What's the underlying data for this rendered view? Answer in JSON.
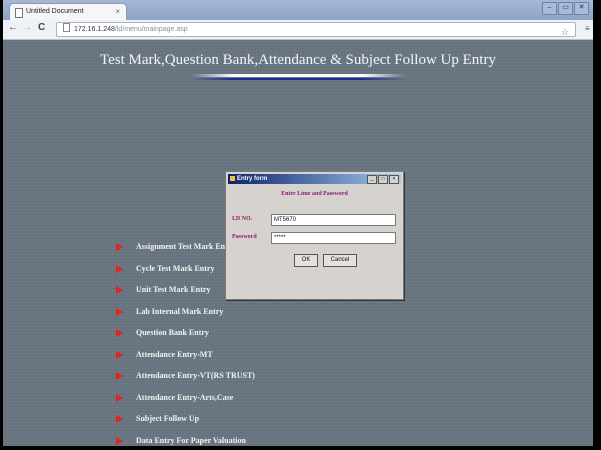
{
  "browser": {
    "tab_title": "Untitled Document",
    "tab_close": "×",
    "url_host": "172.16.1.248",
    "url_path": "/ld/menu/mainpage.asp",
    "window_controls": [
      "–",
      "▭",
      "✕"
    ],
    "nav": {
      "back": "←",
      "forward": "→",
      "reload": "C"
    },
    "bookmark_icon": "star-icon"
  },
  "page": {
    "title": "Test Mark,Question Bank,Attendance & Subject Follow Up Entry",
    "menu_items": [
      "Assignment Test Mark Entry",
      "Cycle Test Mark Entry",
      "Unit Test Mark Entry",
      "Lab Internal Mark Entry",
      "Question Bank Entry",
      "Attendance Entry-MT",
      "Attendance Entry-VT(RS TRUST)",
      "Attendance Entry-Arts,Case",
      "Subject Follow Up",
      "Data Entry For Paper Valuation"
    ]
  },
  "dialog": {
    "title": "Entry form",
    "heading": "Enter Lime and Password",
    "userid_label": "I.D NO.",
    "userid_value": "MT5670",
    "password_label": "Password",
    "password_value": "*****",
    "ok_label": "OK",
    "cancel_label": "Cancel",
    "controls": [
      "_",
      "□",
      "×"
    ]
  },
  "colors": {
    "page_bg": "#66737f",
    "menu_arrow": "#e82020",
    "dialog_label": "#8a1d77"
  }
}
